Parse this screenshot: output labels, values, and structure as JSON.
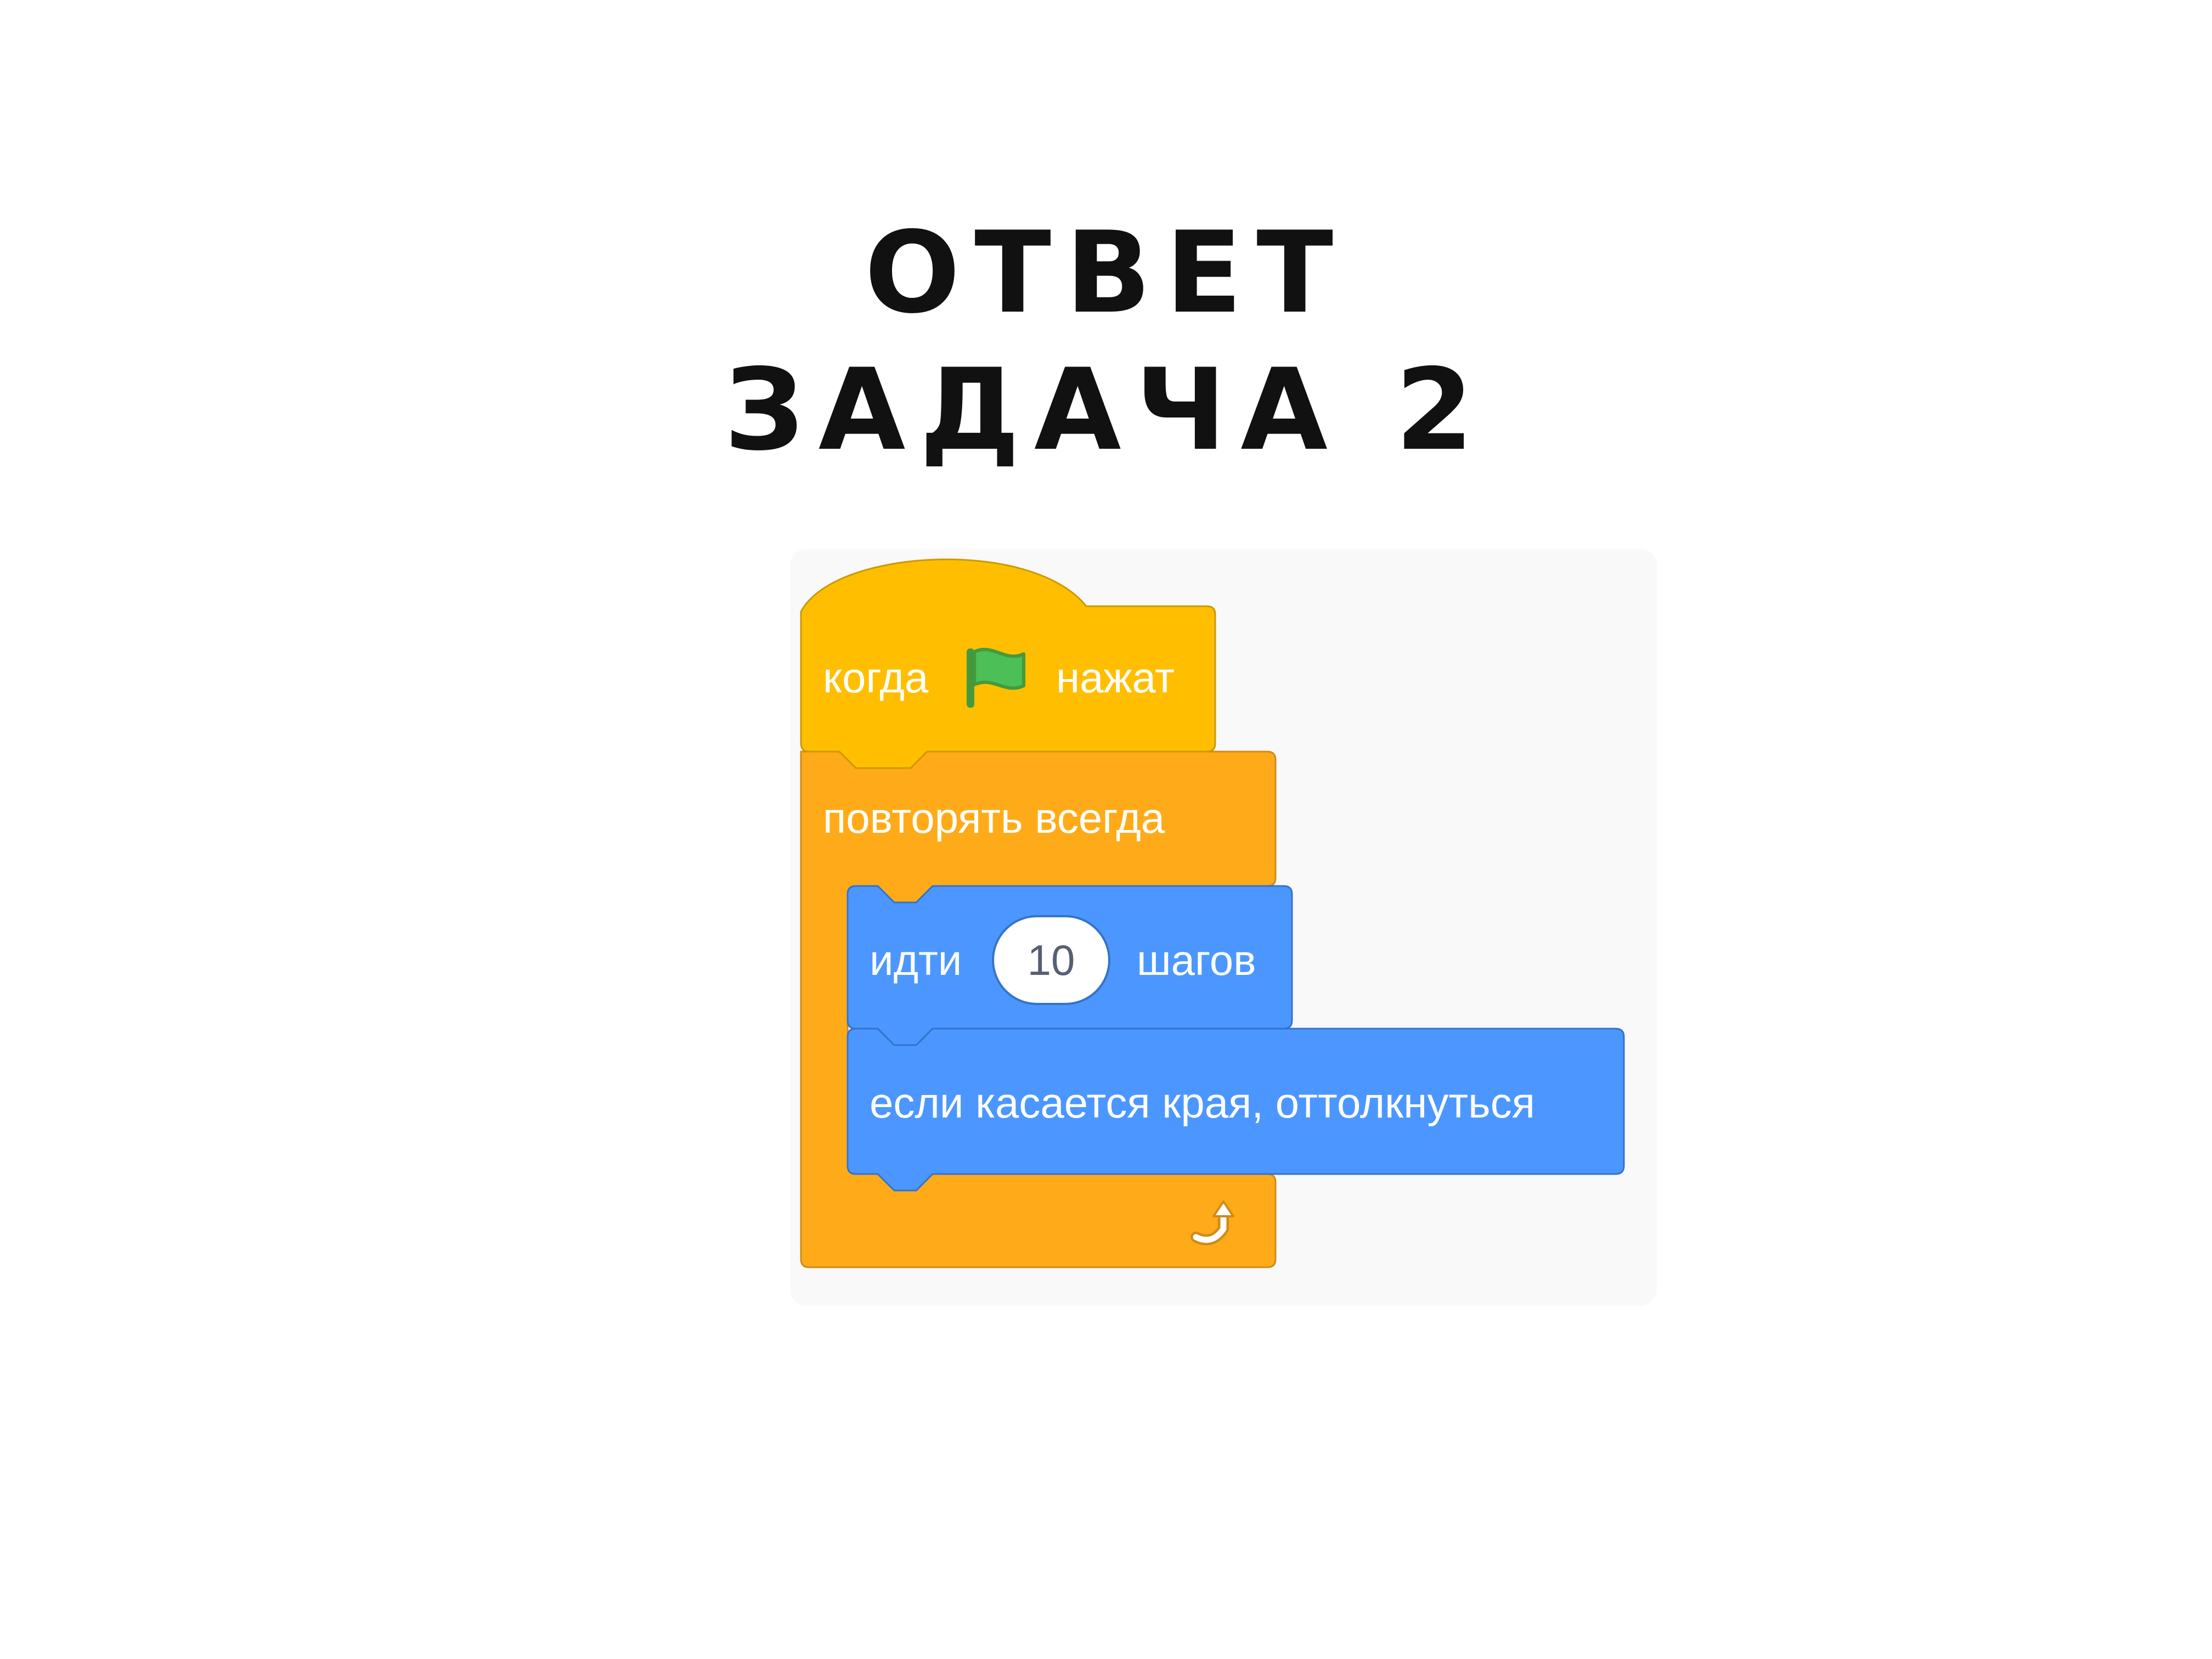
{
  "title": {
    "line1": "Ответ",
    "line2": "Задача 2"
  },
  "script": {
    "hat_block": {
      "label_before": "когда",
      "icon": "green-flag-icon",
      "label_after": "нажат",
      "color": "#ffbf00"
    },
    "forever_block": {
      "label": "повторять всегда",
      "loop_icon": "loop-arrow-icon",
      "color": "#ffab19"
    },
    "move_block": {
      "label_before": "идти",
      "input_value": "10",
      "label_after": "шагов",
      "color": "#4c97ff"
    },
    "bounce_block": {
      "label": "если касается края, оттолкнуться",
      "color": "#4c97ff"
    }
  }
}
